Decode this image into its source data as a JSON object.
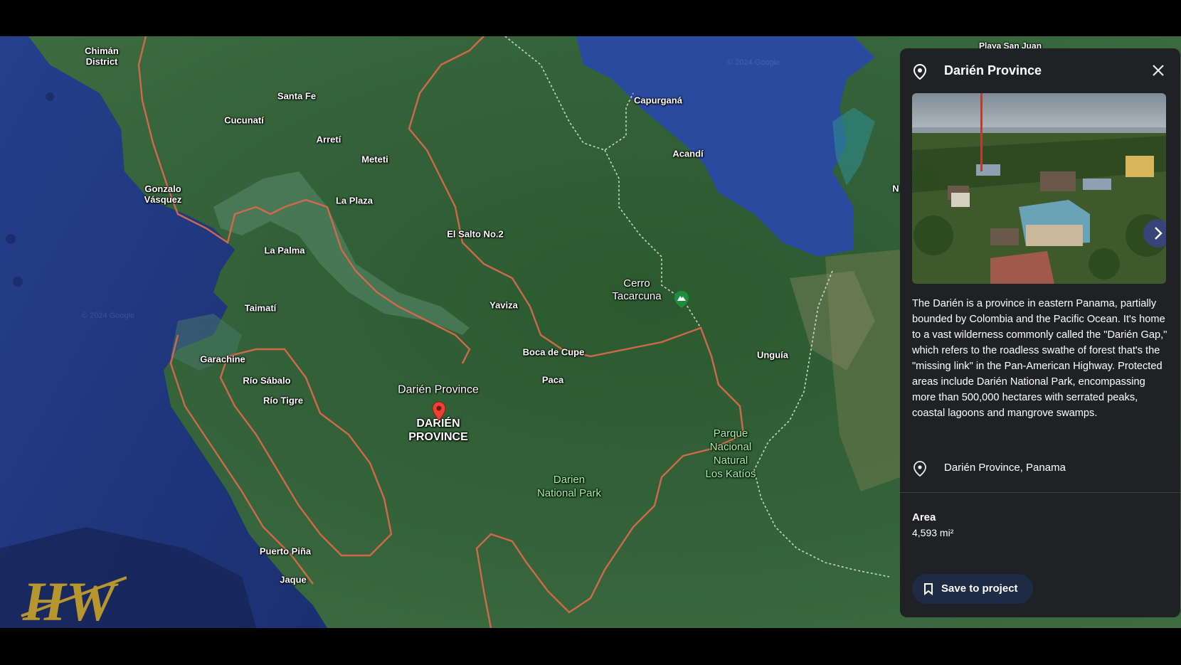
{
  "map": {
    "top_label": "Playa San Juan",
    "labels": {
      "chiman": "Chimán\nDistrict",
      "santa_fe": "Santa Fe",
      "cucunati": "Cucunatí",
      "arreti": "Arretí",
      "meteti": "Meteti",
      "gonzalo": "Gonzalo\nVásquez",
      "la_plaza": "La Plaza",
      "el_salto": "El Salto No.2",
      "la_palma": "La Palma",
      "taimati": "Taimatí",
      "yaviza": "Yaviza",
      "capurgana": "Capurganá",
      "acandi": "Acandí",
      "cerro": "Cerro\nTacarcuna",
      "boca_cupe": "Boca de Cupe",
      "unguia": "Unguía",
      "garachine": "Garachine",
      "rio_sabalo": "Río Sábalo",
      "rio_tigre": "Río Tigre",
      "paca": "Paca",
      "darien_province": "Darién Province",
      "darien_caps": "DARIÉN\nPROVINCE",
      "darien_park": "Darien\nNational Park",
      "los_katios": "Parque\nNacional\nNatural\nLos Katíos",
      "puerto_pina": "Puerto Piña",
      "jaque": "Jaque",
      "edge_n": "N"
    },
    "watermark": "© 2024 Google"
  },
  "logo": {
    "text": "HW",
    "color": "#b8962e"
  },
  "panel": {
    "title": "Darién Province",
    "description": "The Darién is a province in eastern Panama, partially bounded by Colombia and the Pacific Ocean. It's home to a vast wilderness commonly called the \"Darién Gap,\" which refers to the roadless swathe of forest that's the \"missing link\" in the Pan-American Highway. Protected areas include Darién National Park, encompassing more than 500,000 hectares with serrated peaks, coastal lagoons and mangrove swamps.",
    "location": "Darién Province, Panama",
    "area_label": "Area",
    "area_value": "4,593 mi²",
    "save_label": "Save to project",
    "icons": {
      "place": "location-pin-icon",
      "close": "close-icon",
      "next": "chevron-right-icon",
      "save": "bookmark-icon"
    }
  },
  "colors": {
    "panel_bg": "#202124",
    "border": "#d9694a",
    "park_text": "#a5f3a8",
    "pin": "#ea4335"
  }
}
